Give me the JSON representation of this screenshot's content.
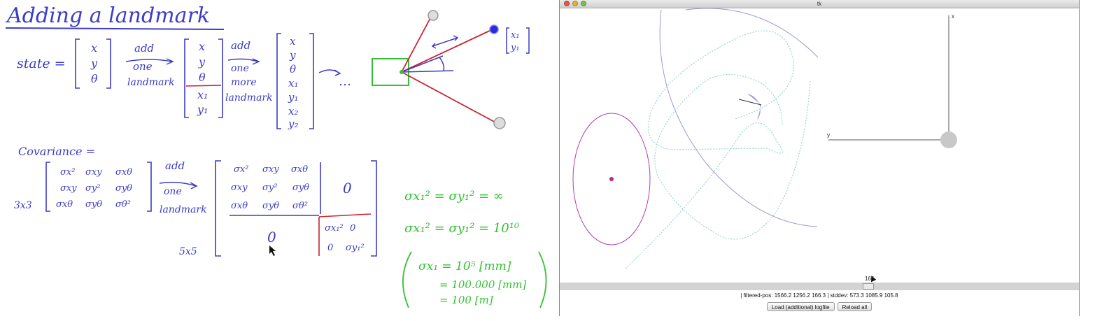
{
  "whiteboard": {
    "title": "Adding a landmark",
    "state_label": "state =",
    "state_vector": [
      "x",
      "y",
      "θ"
    ],
    "arrow1": [
      "add",
      "one",
      "landmark"
    ],
    "state_vector_2": [
      "x",
      "y",
      "θ",
      "x₁",
      "y₁"
    ],
    "arrow2": [
      "add",
      "one",
      "more",
      "landmark"
    ],
    "state_vector_3": [
      "x",
      "y",
      "θ",
      "x₁",
      "y₁",
      "x₂",
      "y₂"
    ],
    "ellipsis": "…",
    "landmark_label": [
      "x₁",
      "y₁"
    ],
    "covariance_label": "Covariance =",
    "size_3x3": "3x3",
    "size_5x5": "5x5",
    "cov3": [
      [
        "σx²",
        "σxy",
        "σxθ"
      ],
      [
        "σxy",
        "σy²",
        "σyθ"
      ],
      [
        "σxθ",
        "σyθ",
        "σθ²"
      ]
    ],
    "arrow3": [
      "add",
      "one",
      "landmark"
    ],
    "cov5_zero_right": "0",
    "cov5_zero_bottom": "0",
    "cov5_block": [
      [
        "σx₁²",
        "0"
      ],
      [
        "0",
        "σy₁²"
      ]
    ],
    "eq1": "σx₁² = σy₁² = ∞",
    "eq2": "σx₁² = σy₁² = 10¹⁰",
    "eq3a": "σx₁ = 10⁵ [mm]",
    "eq3b": "= 100.000 [mm]",
    "eq3c": "= 100 [m]"
  },
  "window": {
    "title": "tk",
    "axis_x": "x",
    "axis_y": "y",
    "scale_value": "166",
    "status": "| filtered-pos: 1566.2 1256.2 166.3 | stddev: 573.3 1085.9 105.8",
    "load_button": "Load (additional) logfile",
    "reload_button": "Reload all"
  }
}
